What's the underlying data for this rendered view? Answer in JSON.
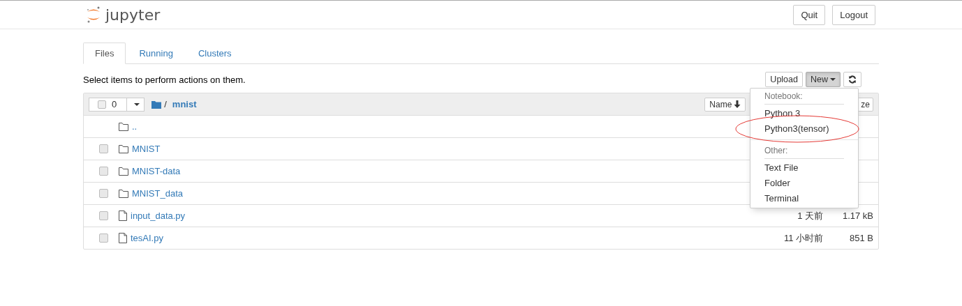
{
  "header": {
    "logo": "jupyter",
    "buttons": [
      "Quit",
      "Logout"
    ]
  },
  "tabs": [
    {
      "label": "Files",
      "selected": true
    },
    {
      "label": "Running",
      "selected": false
    },
    {
      "label": "Clusters",
      "selected": false
    }
  ],
  "hint": "Select items to perform actions on them.",
  "toolbar": {
    "upload": "Upload",
    "new": "New",
    "new_open": true
  },
  "list": {
    "all_checked": false,
    "selected_count": "0",
    "path_sep": "/",
    "folder": "mnist",
    "sort_button": "Name",
    "size_button": "ze",
    "rows": [
      {
        "kind": "up",
        "name": ".."
      },
      {
        "kind": "folder",
        "name": "MNIST",
        "checked": false
      },
      {
        "kind": "folder",
        "name": "MNIST-data",
        "checked": false
      },
      {
        "kind": "folder",
        "name": "MNIST_data",
        "checked": false
      },
      {
        "kind": "file",
        "name": "input_data.py",
        "checked": false,
        "modified": "1 天前",
        "size": "1.17 kB"
      },
      {
        "kind": "file",
        "name": "tesAI.py",
        "checked": false,
        "modified": "11 小时前",
        "size": "851 B"
      }
    ]
  },
  "new_menu": [
    {
      "kind": "header",
      "label": "Notebook:"
    },
    {
      "kind": "item",
      "label": "Python 3",
      "highlighted": false
    },
    {
      "kind": "item",
      "label": "Python3(tensor)",
      "highlighted": true
    },
    {
      "kind": "divider"
    },
    {
      "kind": "header",
      "label": "Other:"
    },
    {
      "kind": "item",
      "label": "Text File",
      "highlighted": false
    },
    {
      "kind": "item",
      "label": "Folder",
      "highlighted": false
    },
    {
      "kind": "item",
      "label": "Terminal",
      "highlighted": false
    }
  ]
}
